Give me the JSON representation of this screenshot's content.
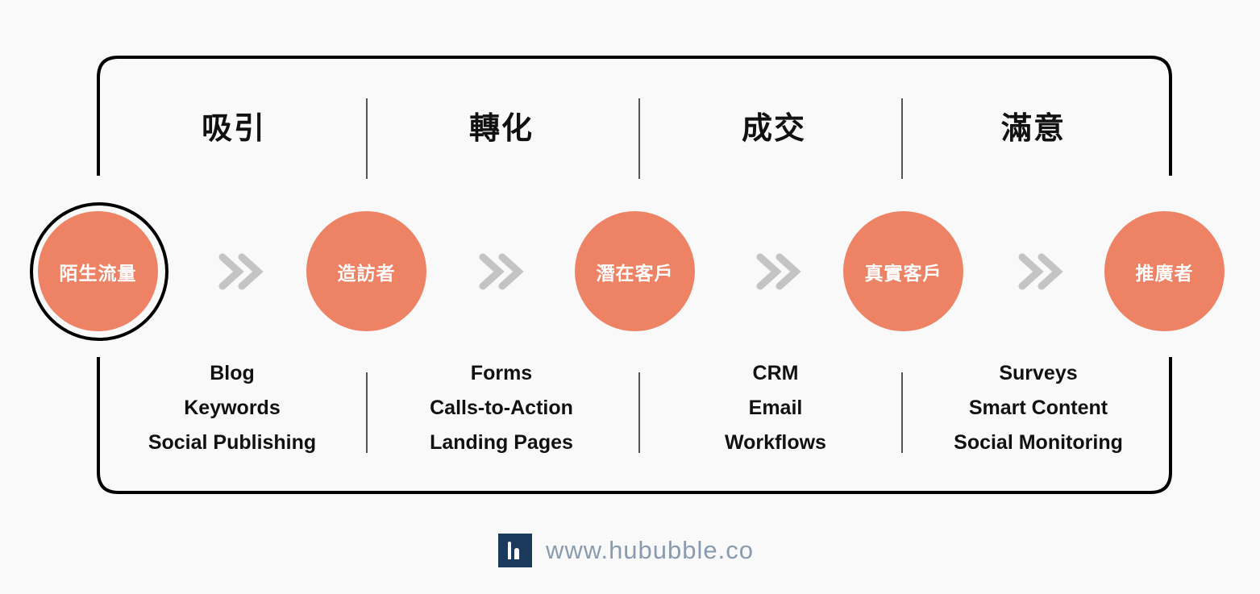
{
  "stages": [
    {
      "title": "吸引",
      "tools": [
        "Blog",
        "Keywords",
        "Social Publishing"
      ]
    },
    {
      "title": "轉化",
      "tools": [
        "Forms",
        "Calls-to-Action",
        "Landing Pages"
      ]
    },
    {
      "title": "成交",
      "tools": [
        "CRM",
        "Email",
        "Workflows"
      ]
    },
    {
      "title": "滿意",
      "tools": [
        "Surveys",
        "Smart Content",
        "Social Monitoring"
      ]
    }
  ],
  "nodes": [
    "陌生流量",
    "造訪者",
    "潛在客戶",
    "真實客戶",
    "推廣者"
  ],
  "connector_icon": "double-chevron-right-icon",
  "footer": {
    "website": "www.hububble.co",
    "logo": "hububble-logo"
  },
  "colors": {
    "node": "#ee8265",
    "arrow": "#c4c4c4",
    "frame": "#000000",
    "logo_bg": "#1b3a5c",
    "site_text": "#8a9bb0"
  }
}
